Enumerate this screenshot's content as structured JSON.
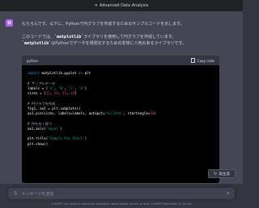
{
  "window": {
    "title": "Advanced Data Analysis",
    "title_icon": "sparkle-icon"
  },
  "message": {
    "paragraph1": "もちろんです。以下に、Pythonで円グラフを作成するためのサンプルコードを示します。",
    "paragraph2_a": "このコードでは、",
    "paragraph2_code1": "`matplotlib`",
    "paragraph2_b": "ライブラリを使用して円グラフを作成しています。",
    "paragraph2_code2": "`matplotlib`",
    "paragraph2_c": "はPythonでデータを視覚化するための非常に人気のあるライブラリです。"
  },
  "code": {
    "language": "python",
    "copy_label": "Copy code",
    "lines": [
      [
        [
          "kw",
          "import"
        ],
        [
          "pl",
          " matplotlib.pyplot "
        ],
        [
          "kw",
          "as"
        ],
        [
          "pl",
          " plt"
        ]
      ],
      [
        [
          "pl",
          ""
        ]
      ],
      [
        [
          "cm",
          "# サンプルデータ"
        ]
      ],
      [
        [
          "pl",
          "labels = ["
        ],
        [
          "st",
          "'A'"
        ],
        [
          "pl",
          ", "
        ],
        [
          "st",
          "'B'"
        ],
        [
          "pl",
          ", "
        ],
        [
          "st",
          "'C'"
        ],
        [
          "pl",
          ", "
        ],
        [
          "st",
          "'D'"
        ],
        [
          "pl",
          "]"
        ]
      ],
      [
        [
          "pl",
          "sizes = ["
        ],
        [
          "nm",
          "15"
        ],
        [
          "pl",
          ", "
        ],
        [
          "nm",
          "30"
        ],
        [
          "pl",
          ", "
        ],
        [
          "nm",
          "45"
        ],
        [
          "pl",
          ", "
        ],
        [
          "nm",
          "10"
        ],
        [
          "pl",
          "]"
        ]
      ],
      [
        [
          "pl",
          ""
        ]
      ],
      [
        [
          "cm",
          "# 円グラフを作成"
        ]
      ],
      [
        [
          "pl",
          "fig1, ax1 = plt.subplots()"
        ]
      ],
      [
        [
          "pl",
          "ax1.pie(sizes, labels=labels, autopct="
        ],
        [
          "st",
          "'%1.1f%%'"
        ],
        [
          "pl",
          ", startangle="
        ],
        [
          "nm",
          "90"
        ],
        [
          "pl",
          ")"
        ]
      ],
      [
        [
          "pl",
          ""
        ]
      ],
      [
        [
          "cm",
          "# 円を丸く保つ"
        ]
      ],
      [
        [
          "pl",
          "ax1.axis("
        ],
        [
          "st",
          "'equal'"
        ],
        [
          "pl",
          ")"
        ]
      ],
      [
        [
          "pl",
          ""
        ]
      ],
      [
        [
          "pl",
          "plt.title("
        ],
        [
          "st",
          "'Sample Pie Chart'"
        ],
        [
          "pl",
          ")"
        ]
      ],
      [
        [
          "pl",
          "plt.show()"
        ]
      ]
    ]
  },
  "regenerate": {
    "label": "再生成",
    "icon": "refresh-icon"
  },
  "input": {
    "placeholder": "メッセージを送信"
  },
  "footer": {
    "disclaimer": "ChatGPT may produce inaccurate information about people, places, or facts. ChatGPT September 25 Version"
  },
  "colors": {
    "accent_avatar": "#ab68ff",
    "keyword": "#2e95d3",
    "string": "#00a67d",
    "number": "#df3079",
    "comment": "#a9aebd"
  }
}
